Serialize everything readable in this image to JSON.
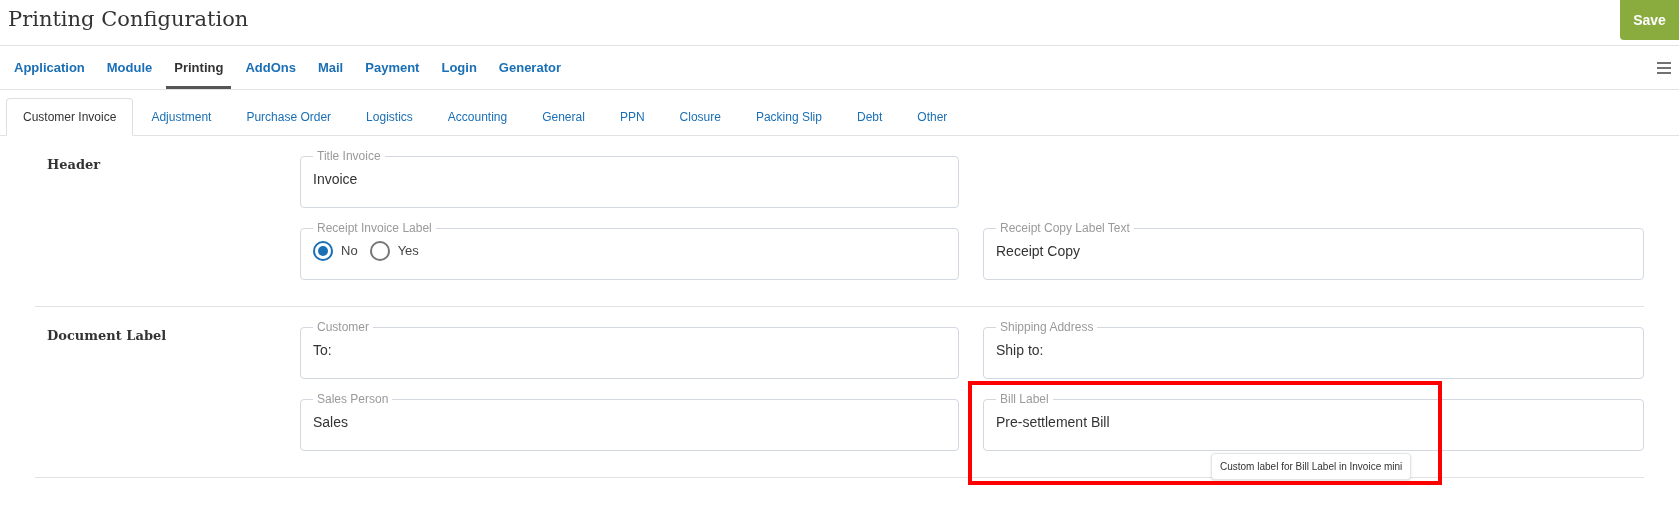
{
  "page_title": "Printing Configuration",
  "save_button": "Save",
  "main_tabs": [
    {
      "label": "Application",
      "selected": false
    },
    {
      "label": "Module",
      "selected": false
    },
    {
      "label": "Printing",
      "selected": true
    },
    {
      "label": "AddOns",
      "selected": false
    },
    {
      "label": "Mail",
      "selected": false
    },
    {
      "label": "Payment",
      "selected": false
    },
    {
      "label": "Login",
      "selected": false
    },
    {
      "label": "Generator",
      "selected": false
    }
  ],
  "sub_tabs": [
    {
      "label": "Customer Invoice",
      "selected": true
    },
    {
      "label": "Adjustment",
      "selected": false
    },
    {
      "label": "Purchase Order",
      "selected": false
    },
    {
      "label": "Logistics",
      "selected": false
    },
    {
      "label": "Accounting",
      "selected": false
    },
    {
      "label": "General",
      "selected": false
    },
    {
      "label": "PPN",
      "selected": false
    },
    {
      "label": "Closure",
      "selected": false
    },
    {
      "label": "Packing Slip",
      "selected": false
    },
    {
      "label": "Debt",
      "selected": false
    },
    {
      "label": "Other",
      "selected": false
    }
  ],
  "sections": [
    {
      "title": "Header",
      "rows": [
        [
          {
            "kind": "text",
            "label": "Title Invoice",
            "value": "Invoice",
            "highlighted": false
          }
        ],
        [
          {
            "kind": "radio",
            "label": "Receipt Invoice Label",
            "options": [
              {
                "label": "No",
                "selected": true
              },
              {
                "label": "Yes",
                "selected": false
              }
            ],
            "highlighted": false
          },
          {
            "kind": "text",
            "label": "Receipt Copy Label Text",
            "value": "Receipt Copy",
            "highlighted": false
          }
        ]
      ]
    },
    {
      "title": "Document Label",
      "rows": [
        [
          {
            "kind": "text",
            "label": "Customer",
            "value": "To:",
            "highlighted": false
          },
          {
            "kind": "text",
            "label": "Shipping Address",
            "value": "Ship to:",
            "highlighted": false
          }
        ],
        [
          {
            "kind": "text",
            "label": "Sales Person",
            "value": "Sales",
            "highlighted": false
          },
          {
            "kind": "text",
            "label": "Bill Label",
            "value": "Pre-settlement Bill",
            "highlighted": true,
            "tooltip": "Custom label for Bill Label in Invoice mini"
          }
        ]
      ]
    }
  ]
}
